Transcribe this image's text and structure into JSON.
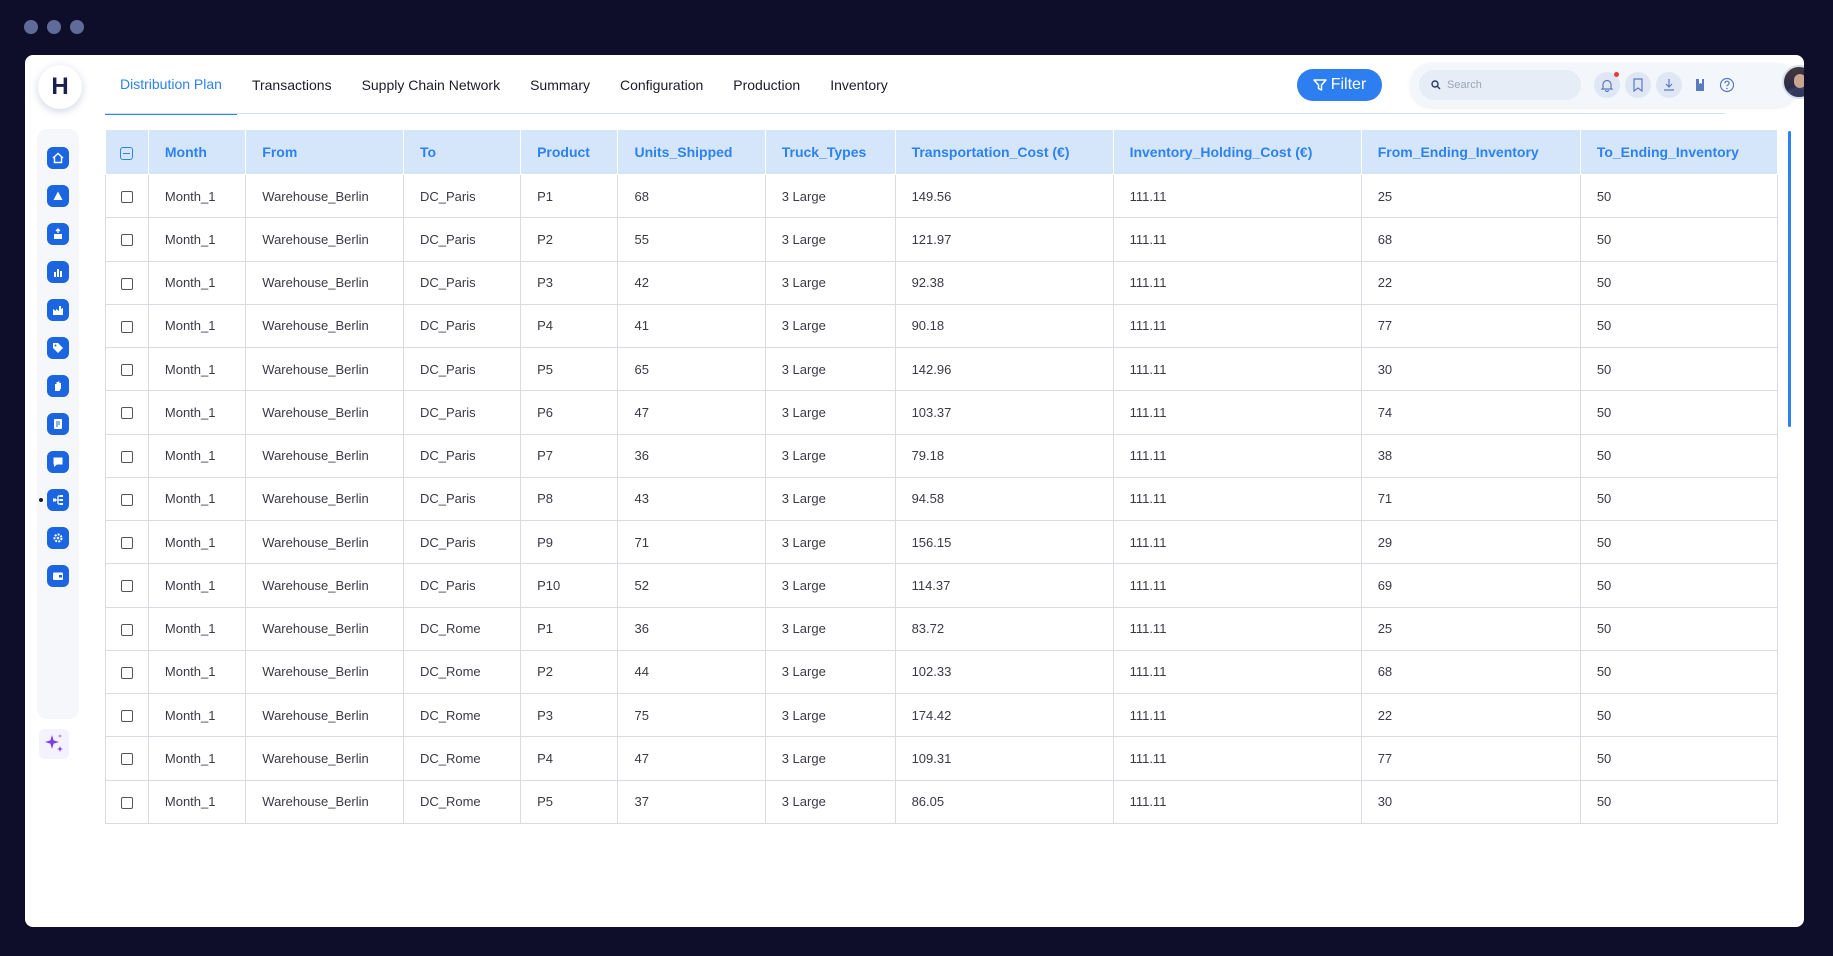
{
  "app": {
    "logo_letter": "H"
  },
  "tabs": [
    {
      "label": "Distribution Plan",
      "active": true
    },
    {
      "label": "Transactions"
    },
    {
      "label": "Supply Chain Network"
    },
    {
      "label": "Summary"
    },
    {
      "label": "Configuration"
    },
    {
      "label": "Production"
    },
    {
      "label": "Inventory"
    }
  ],
  "toolbar": {
    "filter_label": "Filter",
    "search_placeholder": "Search"
  },
  "sidebar": {
    "items": [
      {
        "icon": "home-icon"
      },
      {
        "icon": "alert-icon"
      },
      {
        "icon": "box-upload-icon"
      },
      {
        "icon": "bar-chart-icon"
      },
      {
        "icon": "factory-icon"
      },
      {
        "icon": "tag-icon"
      },
      {
        "icon": "hand-icon"
      },
      {
        "icon": "report-icon"
      },
      {
        "icon": "message-icon"
      },
      {
        "icon": "distribution-icon",
        "active": true
      },
      {
        "icon": "settings-icon"
      },
      {
        "icon": "wallet-icon"
      }
    ],
    "ai_icon": "sparkle-icon"
  },
  "colors": {
    "accent": "#2b82f0",
    "header_bg": "#d6e6fa",
    "frame": "#0f0e2a"
  },
  "table": {
    "columns": [
      "Month",
      "From",
      "To",
      "Product",
      "Units_Shipped",
      "Truck_Types",
      "Transportation_Cost (€)",
      "Inventory_Holding_Cost (€)",
      "From_Ending_Inventory",
      "To_Ending_Inventory"
    ],
    "rows": [
      [
        "Month_1",
        "Warehouse_Berlin",
        "DC_Paris",
        "P1",
        "68",
        "3 Large",
        "149.56",
        "111.11",
        "25",
        "50"
      ],
      [
        "Month_1",
        "Warehouse_Berlin",
        "DC_Paris",
        "P2",
        "55",
        "3 Large",
        "121.97",
        "111.11",
        "68",
        "50"
      ],
      [
        "Month_1",
        "Warehouse_Berlin",
        "DC_Paris",
        "P3",
        "42",
        "3 Large",
        "92.38",
        "111.11",
        "22",
        "50"
      ],
      [
        "Month_1",
        "Warehouse_Berlin",
        "DC_Paris",
        "P4",
        "41",
        "3 Large",
        "90.18",
        "111.11",
        "77",
        "50"
      ],
      [
        "Month_1",
        "Warehouse_Berlin",
        "DC_Paris",
        "P5",
        "65",
        "3 Large",
        "142.96",
        "111.11",
        "30",
        "50"
      ],
      [
        "Month_1",
        "Warehouse_Berlin",
        "DC_Paris",
        "P6",
        "47",
        "3 Large",
        "103.37",
        "111.11",
        "74",
        "50"
      ],
      [
        "Month_1",
        "Warehouse_Berlin",
        "DC_Paris",
        "P7",
        "36",
        "3 Large",
        "79.18",
        "111.11",
        "38",
        "50"
      ],
      [
        "Month_1",
        "Warehouse_Berlin",
        "DC_Paris",
        "P8",
        "43",
        "3 Large",
        "94.58",
        "111.11",
        "71",
        "50"
      ],
      [
        "Month_1",
        "Warehouse_Berlin",
        "DC_Paris",
        "P9",
        "71",
        "3 Large",
        "156.15",
        "111.11",
        "29",
        "50"
      ],
      [
        "Month_1",
        "Warehouse_Berlin",
        "DC_Paris",
        "P10",
        "52",
        "3 Large",
        "114.37",
        "111.11",
        "69",
        "50"
      ],
      [
        "Month_1",
        "Warehouse_Berlin",
        "DC_Rome",
        "P1",
        "36",
        "3 Large",
        "83.72",
        "111.11",
        "25",
        "50"
      ],
      [
        "Month_1",
        "Warehouse_Berlin",
        "DC_Rome",
        "P2",
        "44",
        "3 Large",
        "102.33",
        "111.11",
        "68",
        "50"
      ],
      [
        "Month_1",
        "Warehouse_Berlin",
        "DC_Rome",
        "P3",
        "75",
        "3 Large",
        "174.42",
        "111.11",
        "22",
        "50"
      ],
      [
        "Month_1",
        "Warehouse_Berlin",
        "DC_Rome",
        "P4",
        "47",
        "3 Large",
        "109.31",
        "111.11",
        "77",
        "50"
      ],
      [
        "Month_1",
        "Warehouse_Berlin",
        "DC_Rome",
        "P5",
        "37",
        "3 Large",
        "86.05",
        "111.11",
        "30",
        "50"
      ]
    ]
  }
}
